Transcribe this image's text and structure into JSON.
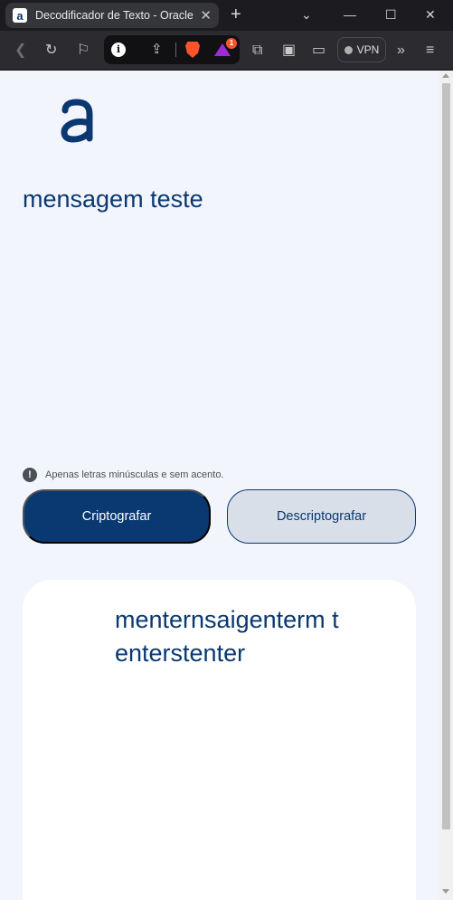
{
  "browser": {
    "tab_title": "Decodificador de Texto - Oracle",
    "favicon_letter": "a",
    "vpn_label": "VPN",
    "notification_count": "1"
  },
  "app": {
    "input_text": "mensagem teste",
    "hint_text": "Apenas letras minúsculas e sem acento.",
    "encrypt_label": "Criptografar",
    "decrypt_label": "Descriptografar",
    "output_text": "menternsaigenterm tenterstenter",
    "colors": {
      "primary": "#0a3871",
      "background": "#f3f5fc",
      "secondary_button": "#d8dfe8"
    }
  }
}
